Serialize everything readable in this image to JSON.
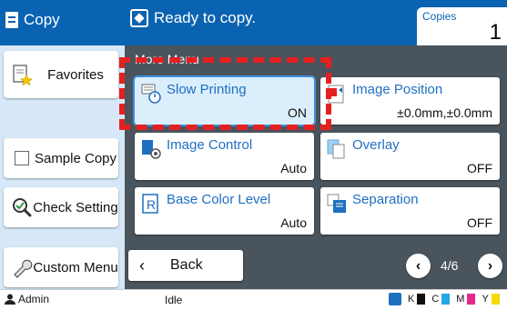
{
  "header": {
    "app_title": "Copy",
    "status_message": "Ready to copy.",
    "copies_label": "Copies",
    "copies_value": "1"
  },
  "left_panel": {
    "favorites_label": "Favorites",
    "sample_copy_label": "Sample Copy",
    "check_setting_label": "Check Setting",
    "custom_menu_label": "Custom Menu"
  },
  "menu": {
    "title": "More Menu",
    "tiles": [
      {
        "name": "Slow Printing",
        "value": "ON",
        "icon": "slow-printing-icon"
      },
      {
        "name": "Image Position",
        "value": "±0.0mm,±0.0mm",
        "icon": "image-position-icon"
      },
      {
        "name": "Image Control",
        "value": "Auto",
        "icon": "image-control-icon"
      },
      {
        "name": "Overlay",
        "value": "OFF",
        "icon": "overlay-icon"
      },
      {
        "name": "Base Color Level",
        "value": "Auto",
        "icon": "base-color-icon"
      },
      {
        "name": "Separation",
        "value": "OFF",
        "icon": "separation-icon"
      }
    ]
  },
  "navigation": {
    "back_label": "Back",
    "page_indicator": "4/6"
  },
  "status_bar": {
    "user": "Admin",
    "machine_status": "Idle",
    "toner_labels": [
      "K",
      "C",
      "M",
      "Y"
    ]
  },
  "colors": {
    "header_blue": "#0a63b1",
    "panel_light_blue": "#d6e8f7",
    "background_gray": "#4a545c",
    "highlight_red": "#e62020",
    "toner_k": "#111111",
    "toner_c": "#22a7e8",
    "toner_m": "#e8268e",
    "toner_y": "#f5d90a"
  }
}
